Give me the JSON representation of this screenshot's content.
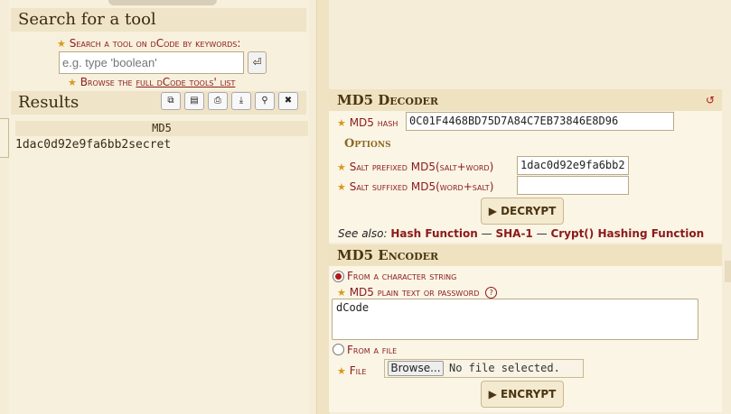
{
  "search": {
    "title": "Search for a tool",
    "keywords_label": "Search a tool on dCode by keywords:",
    "placeholder": "e.g. type 'boolean'",
    "go_icon": "⏎",
    "browse_prefix": "Browse the",
    "browse_link": "full dCode tools' list"
  },
  "results": {
    "title": "Results",
    "toolbar": [
      "copy-icon",
      "clipboard-icon",
      "print-icon",
      "download-icon",
      "pin-icon",
      "close-icon"
    ],
    "column_header": "MD5",
    "value": "1dac0d92e9fa6bb2secret"
  },
  "decoder": {
    "title": "MD5 Decoder",
    "hash_label": "MD5 hash",
    "hash_value": "0C01F4468BD75D7A84C7EB73846E8D96",
    "options_title": "Options",
    "salt_prefix_label": "Salt prefixed MD5(salt+word)",
    "salt_prefix_value": "1dac0d92e9fa6bb2",
    "salt_suffix_label": "Salt suffixed MD5(word+salt)",
    "salt_suffix_value": "",
    "decrypt_label": "▶ DECRYPT",
    "see_also_label": "See also:",
    "see_also_links": [
      "Hash Function",
      "SHA-1",
      "Crypt() Hashing Function"
    ],
    "separator": "—"
  },
  "encoder": {
    "title": "MD5 Encoder",
    "radio_string_label": "From a character string",
    "plain_label": "MD5 plain text or password",
    "help_icon": "?",
    "plain_value": "dCode",
    "radio_file_label": "From a file",
    "file_label": "File",
    "browse_label": "Browse...",
    "no_file_text": "No file selected.",
    "encrypt_label": "▶ ENCRYPT"
  }
}
